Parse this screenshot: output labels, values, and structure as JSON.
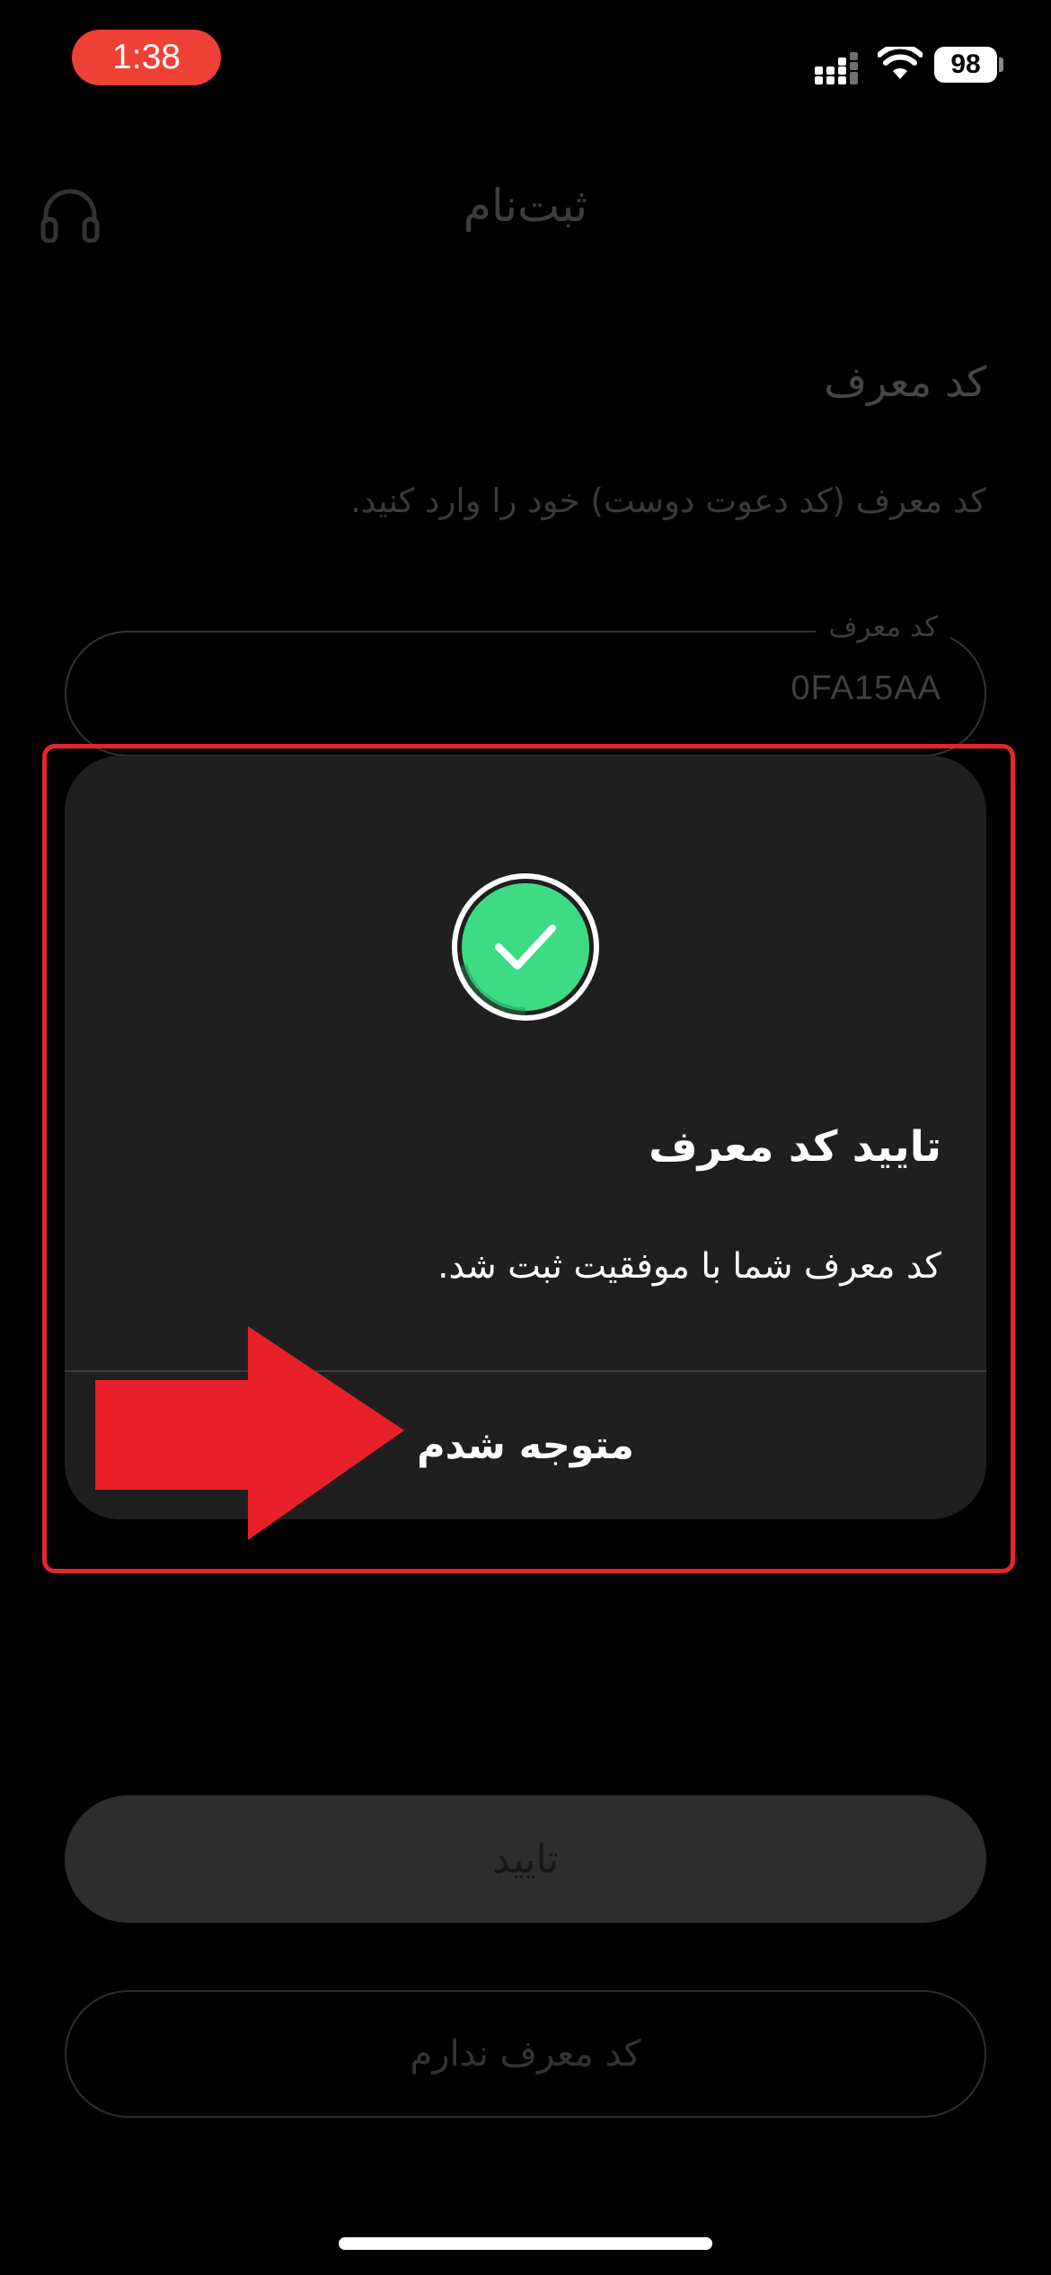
{
  "status_bar": {
    "time": "1:38",
    "battery": "98",
    "icons": [
      "signal-icon",
      "wifi-icon",
      "battery-icon"
    ],
    "time_pill_color": "#ef4136"
  },
  "header": {
    "title": "ثبت‌نام",
    "support_icon": "headphones-icon"
  },
  "referral_section": {
    "title": "کد معرف",
    "description": "کد معرف (کد دعوت دوست) خود را وارد کنید.",
    "field_label": "کد معرف",
    "field_value": "0FA15AA"
  },
  "dialog": {
    "icon": "check-circle-icon",
    "icon_color": "#3ddc84",
    "title": "تایید کد معرف",
    "message": "کد معرف شما با موفقیت ثبت شد.",
    "ok_button": "متوجه شدم"
  },
  "actions": {
    "confirm_button": "تایید",
    "no_code_button": "کد معرف ندارم"
  },
  "annotations": {
    "highlight_color": "#e3262e",
    "arrow_color": "#e8202a"
  }
}
